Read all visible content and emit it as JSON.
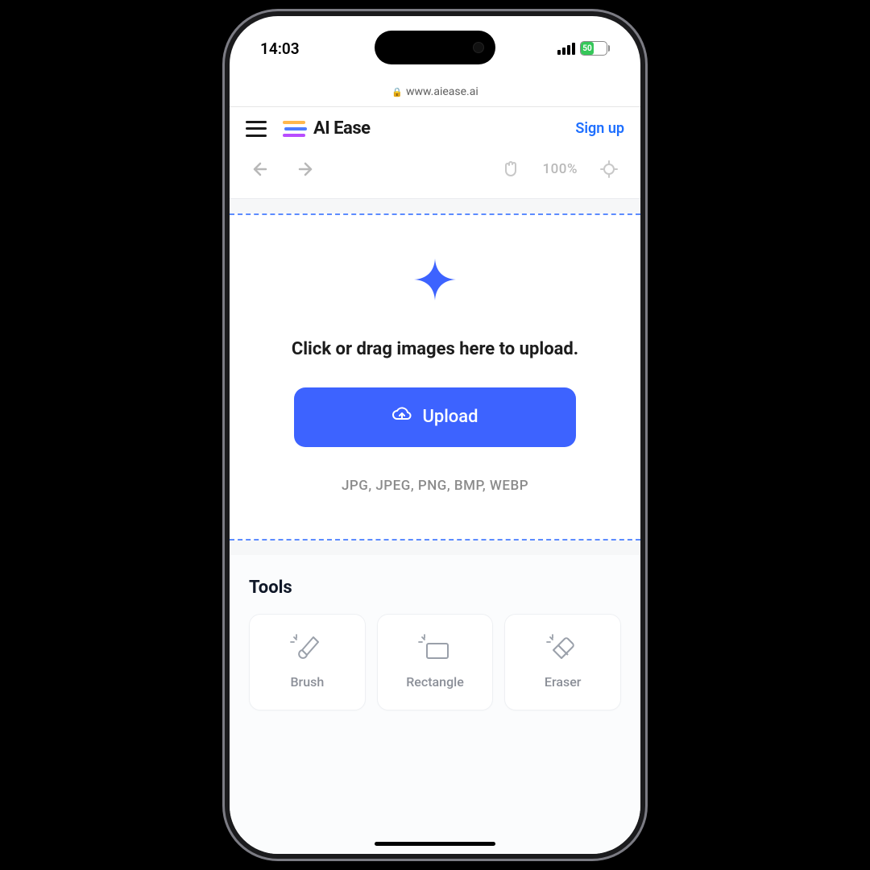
{
  "statusbar": {
    "time": "14:03",
    "battery_pct": "50"
  },
  "browser": {
    "url": "www.aiease.ai"
  },
  "header": {
    "logo_text": "AI Ease",
    "signup_label": "Sign up"
  },
  "toolbar": {
    "zoom": "100%"
  },
  "dropzone": {
    "prompt": "Click or drag images here to upload.",
    "button_label": "Upload",
    "formats": "JPG,  JPEG,  PNG,  BMP,  WEBP"
  },
  "tools": {
    "title": "Tools",
    "items": [
      {
        "label": "Brush"
      },
      {
        "label": "Rectangle"
      },
      {
        "label": "Eraser"
      }
    ]
  }
}
